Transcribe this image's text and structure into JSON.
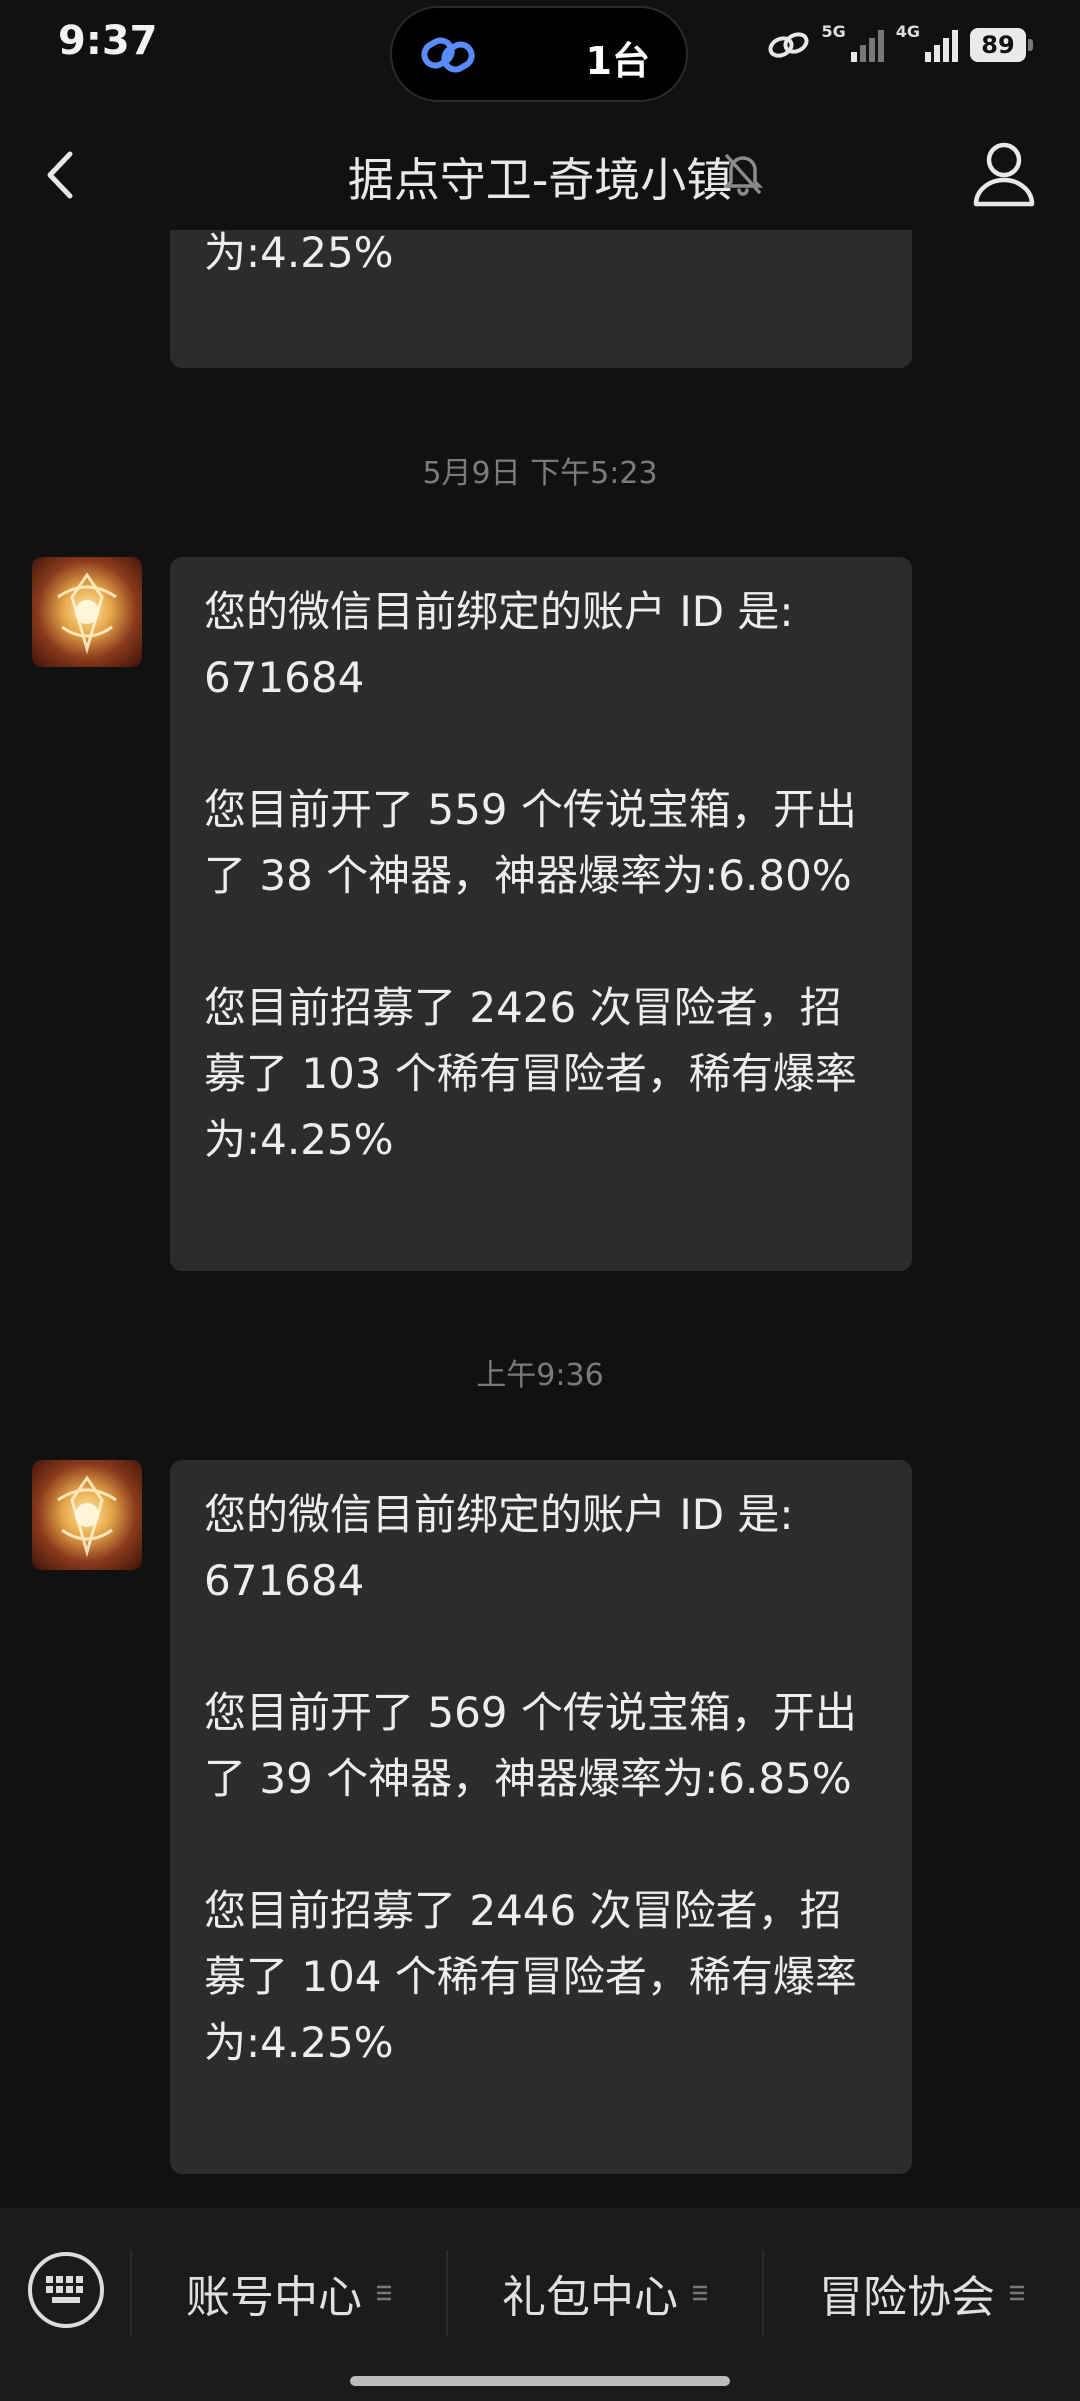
{
  "status_bar": {
    "time": "9:37",
    "island_text": "1台",
    "net_5g": "5G",
    "net_4g": "4G",
    "battery": "89"
  },
  "header": {
    "title": "据点守卫-奇境小镇"
  },
  "messages": {
    "partial_tail": "为:4.25%",
    "timestamp_1": "5月9日 下午5:23",
    "msg1": {
      "line1": "您的微信目前绑定的账户 ID 是:",
      "line2": "671684",
      "line3": "您目前开了 559 个传说宝箱，开出",
      "line4": "了 38 个神器，神器爆率为:6.80%",
      "line5": "您目前招募了 2426 次冒险者，招",
      "line6": "募了 103 个稀有冒险者，稀有爆率",
      "line7": "为:4.25%"
    },
    "timestamp_2": "上午9:36",
    "msg2": {
      "line1": "您的微信目前绑定的账户 ID 是:",
      "line2": "671684",
      "line3": "您目前开了 569 个传说宝箱，开出",
      "line4": "了 39 个神器，神器爆率为:6.85%",
      "line5": "您目前招募了 2446 次冒险者，招",
      "line6": "募了 104 个稀有冒险者，稀有爆率",
      "line7": "为:4.25%"
    }
  },
  "bottom_menu": {
    "item1": "账号中心",
    "item2": "礼包中心",
    "item3": "冒险协会"
  },
  "colors": {
    "background": "#111111",
    "bubble": "#2c2c2c",
    "timestamp": "#7b7b7b",
    "link_icon": "#5b8cff"
  }
}
